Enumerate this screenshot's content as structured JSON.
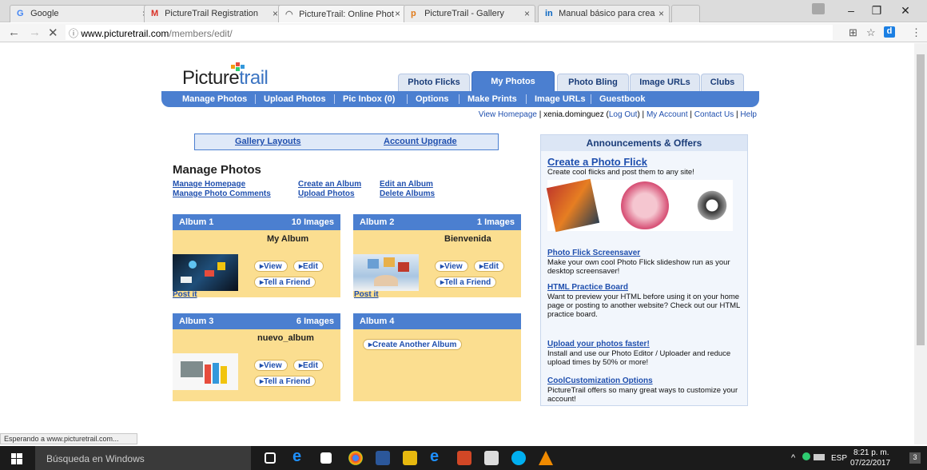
{
  "browser": {
    "tabs": [
      {
        "label": "Google",
        "icon": "G",
        "color": "#4285f4"
      },
      {
        "label": "PictureTrail Registration",
        "icon": "M",
        "color": "#d93025"
      },
      {
        "label": "PictureTrail: Online Phot",
        "icon": "◠",
        "color": "#777777",
        "active": true
      },
      {
        "label": "PictureTrail - Gallery",
        "icon": "p",
        "color": "#e07b1a"
      },
      {
        "label": "Manual básico para crea",
        "icon": "in",
        "color": "#0a66c2"
      }
    ],
    "tab_close": "×",
    "url_host": "www.picturetrail.com",
    "url_path": "/members/edit/",
    "info_icon": "ⓘ"
  },
  "site": {
    "logo": {
      "pre": "Picture",
      "trail": "trail",
      "dot_colors": [
        "#f39c12",
        "#e74c3c",
        "#3498db",
        "#2ecc71"
      ]
    },
    "main_tabs": [
      "Photo Flicks",
      "My Photos",
      "Photo Bling",
      "Image URLs",
      "Clubs"
    ],
    "sub_nav": [
      "Manage Photos",
      "Upload Photos",
      "Pic Inbox (0)",
      "Options",
      "Make Prints",
      "Image URLs",
      "Guestbook"
    ],
    "top_links": {
      "view_homepage": "View Homepage",
      "user": "xenia.dominguez",
      "logout": "Log Out",
      "my_account": "My Account",
      "contact": "Contact Us",
      "help": "Help"
    },
    "box_links": [
      "Gallery Layouts",
      "Account Upgrade"
    ],
    "heading": "Manage Photos",
    "manage_links": [
      "Manage Homepage",
      "Manage Photo Comments",
      "Create an Album",
      "Upload Photos",
      "Edit an Album",
      "Delete Albums"
    ],
    "albums": [
      {
        "name": "Album 1",
        "count": "10 Images",
        "title": "My Album"
      },
      {
        "name": "Album 2",
        "count": "1 Images",
        "title": "Bienvenida"
      },
      {
        "name": "Album 3",
        "count": "6 Images",
        "title": "nuevo_album"
      },
      {
        "name": "Album 4",
        "count": "",
        "title": ""
      }
    ],
    "album_buttons": {
      "view": "▸View",
      "edit": "▸Edit",
      "tell": "▸Tell a Friend",
      "create": "▸Create Another Album"
    },
    "post_it": "Post it",
    "announcements": {
      "header": "Announcements & Offers",
      "flick_title": "Create a Photo Flick",
      "flick_sub": "Create cool flicks and post them to any site!",
      "items": [
        {
          "title": "Photo Flick Screensaver",
          "text": "Make your own cool Photo Flick slideshow run as your desktop screensaver!"
        },
        {
          "title": "HTML Practice Board",
          "text": "Want to preview your HTML before using it on your home page or posting to another website? Check out our HTML practice board."
        },
        {
          "title": "Upload your photos faster!",
          "text": "Install and use our Photo Editor / Uploader and reduce upload times by 50% or more!"
        },
        {
          "title": "CoolCustomization Options",
          "text": "PictureTrail offers so many great ways to customize your account!"
        }
      ]
    }
  },
  "status_text": "Esperando a www.picturetrail.com...",
  "taskbar": {
    "search_placeholder": "Búsqueda en Windows",
    "lang": "ESP",
    "time": "8:21 p. m.",
    "date": "07/22/2017",
    "notif_count": "3"
  }
}
